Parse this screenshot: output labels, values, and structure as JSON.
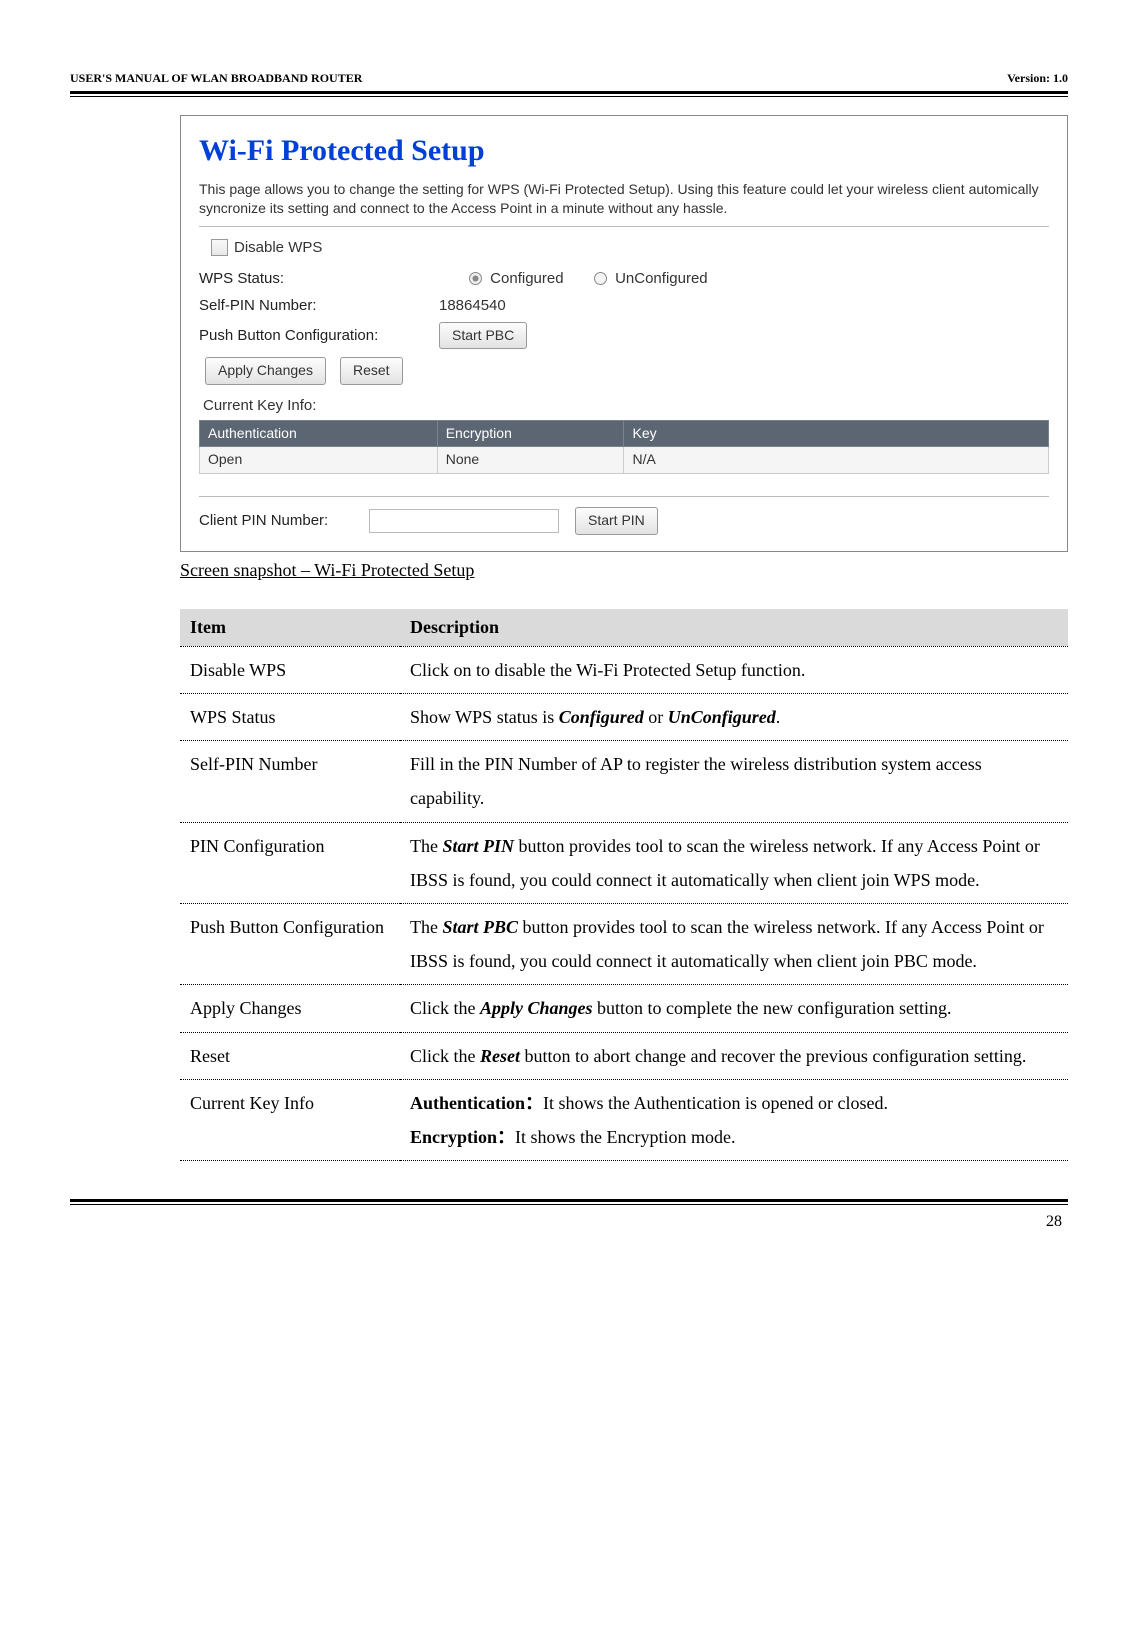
{
  "header": {
    "left": "USER'S MANUAL OF WLAN BROADBAND ROUTER",
    "right": "Version: 1.0"
  },
  "panel": {
    "title": "Wi-Fi Protected Setup",
    "description": "This page allows you to change the setting for WPS (Wi-Fi Protected Setup). Using this feature could let your wireless client automically syncronize its setting and connect to the Access Point in a minute without any hassle.",
    "disable_label": "Disable WPS",
    "wps_status_label": "WPS Status:",
    "configured_label": "Configured",
    "unconfigured_label": "UnConfigured",
    "self_pin_label": "Self-PIN Number:",
    "self_pin_value": "18864540",
    "pbc_label": "Push Button Configuration:",
    "start_pbc_btn": "Start PBC",
    "apply_btn": "Apply Changes",
    "reset_btn": "Reset",
    "current_key_label": "Current Key Info:",
    "kt_auth_h": "Authentication",
    "kt_enc_h": "Encryption",
    "kt_key_h": "Key",
    "kt_auth_v": "Open",
    "kt_enc_v": "None",
    "kt_key_v": "N/A",
    "client_pin_label": "Client PIN Number:",
    "start_pin_btn": "Start PIN"
  },
  "caption": "Screen snapshot – Wi-Fi Protected Setup",
  "table": {
    "h_item": "Item",
    "h_desc": "Description",
    "rows": [
      {
        "item": "Disable WPS",
        "desc_plain": "Click on to disable the Wi-Fi Protected Setup function."
      },
      {
        "item": "WPS Status",
        "desc_pre": "Show WPS status is ",
        "bi1": "Configured",
        "mid": " or ",
        "bi2": "UnConfigured",
        "post": "."
      },
      {
        "item": "Self-PIN Number",
        "desc_plain": "Fill in the PIN Number of AP to register the wireless distribution system access capability."
      },
      {
        "item": "PIN Configuration",
        "desc_pre": "The ",
        "bi1": "Start PIN",
        "post": " button provides tool to scan the wireless network. If any Access Point or IBSS is found, you could connect it automatically when client join WPS mode."
      },
      {
        "item": "Push Button Configuration",
        "desc_pre": "The ",
        "bi1": "Start PBC",
        "post": " button provides tool to scan the wireless network. If any Access Point or IBSS is found, you could connect it automatically when client join PBC mode."
      },
      {
        "item": "Apply Changes",
        "desc_pre": "Click the ",
        "bi1": "Apply Changes",
        "post": " button to complete the new configuration setting."
      },
      {
        "item": "Reset",
        "desc_pre": "Click the ",
        "bi1": "Reset",
        "post": " button to abort change and recover the previous configuration setting."
      },
      {
        "item": "Current Key Info",
        "b1": "Authentication：",
        "t1": "It shows the Authentication is opened or closed.",
        "b2": "Encryption：",
        "t2": "It shows the Encryption mode."
      }
    ]
  },
  "page_number": "28"
}
